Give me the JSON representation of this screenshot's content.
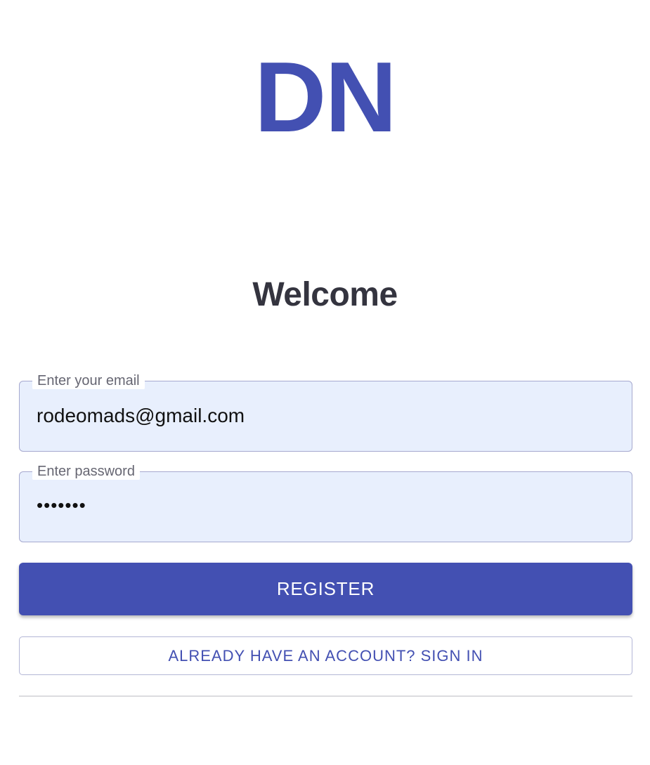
{
  "logo": {
    "text": "DN"
  },
  "heading": "Welcome",
  "form": {
    "email": {
      "label": "Enter your email",
      "value": "rodeomads@gmail.com"
    },
    "password": {
      "label": "Enter password",
      "masked_value": "•••••••"
    }
  },
  "actions": {
    "register_label": "REGISTER",
    "signin_label": "ALREADY HAVE AN ACCOUNT? SIGN IN"
  },
  "colors": {
    "brand": "#4350b2",
    "field_bg": "#e8effd",
    "heading": "#34343f"
  }
}
